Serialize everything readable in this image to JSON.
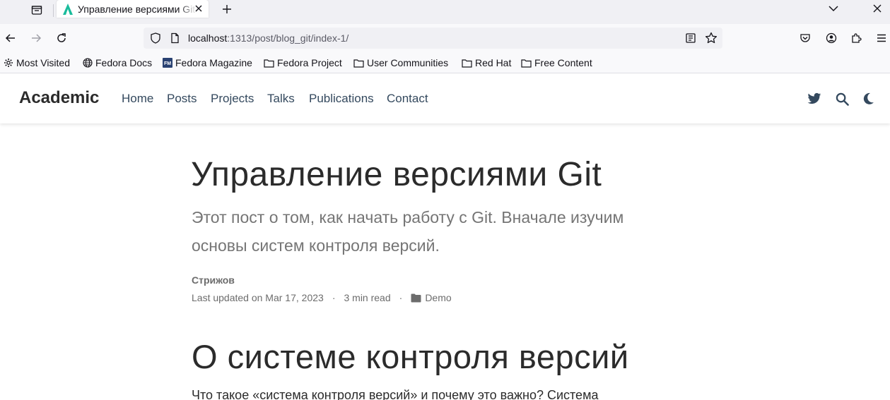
{
  "browser": {
    "tab": {
      "title": "Управление версиями Git"
    },
    "url": {
      "host": "localhost",
      "path": ":1313/post/blog_git/index-1/"
    },
    "bookmarks": [
      {
        "label": "Most Visited",
        "icon": "gear-icon"
      },
      {
        "label": "Fedora Docs",
        "icon": "globe-icon"
      },
      {
        "label": "Fedora Magazine",
        "icon": "fedora-magazine-icon"
      },
      {
        "label": "Fedora Project",
        "icon": "folder-icon"
      },
      {
        "label": "User Communities",
        "icon": "folder-icon"
      },
      {
        "label": "Red Hat",
        "icon": "folder-icon"
      },
      {
        "label": "Free Content",
        "icon": "folder-icon"
      }
    ]
  },
  "site": {
    "brand": "Academic",
    "nav": [
      "Home",
      "Posts",
      "Projects",
      "Talks",
      "Publications",
      "Contact"
    ]
  },
  "article": {
    "title": "Управление версиями Git",
    "summary": "Этот пост о том, как начать работу с Git. Вначале изучим основы систем контроля версий.",
    "author": "Стрижов",
    "updated": "Last updated on Mar 17, 2023",
    "read_time": "3 min read",
    "category": "Demo",
    "separator": "·",
    "section_heading": "О системе контроля версий",
    "first_paragraph": "Что такое «система контроля версий» и почему это важно? Система"
  },
  "colors": {
    "accent": "#34495e",
    "favicon": "#1abc9c"
  }
}
